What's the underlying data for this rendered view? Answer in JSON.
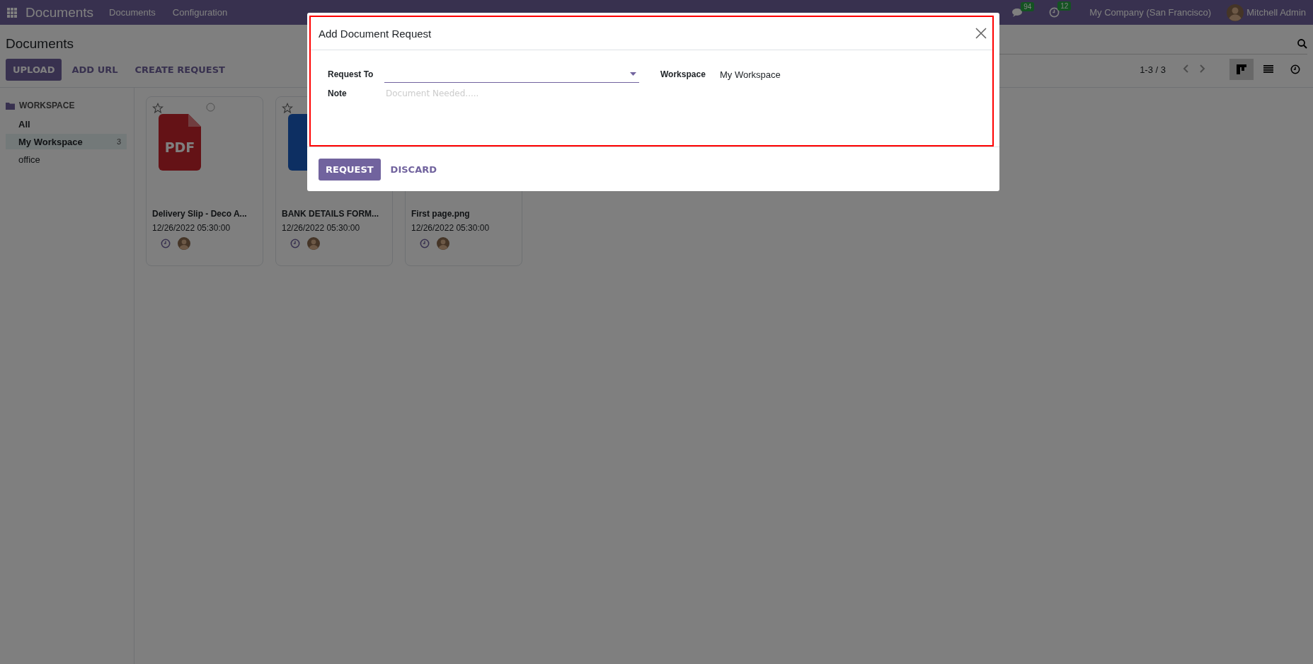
{
  "navbar": {
    "app_name": "Documents",
    "menus": [
      "Documents",
      "Configuration"
    ],
    "messages_count": "94",
    "activities_count": "12",
    "company": "My Company (San Francisco)",
    "user": "Mitchell Admin"
  },
  "control_panel": {
    "title": "Documents",
    "buttons": [
      {
        "label": "UPLOAD",
        "kind": "primary"
      },
      {
        "label": "ADD URL",
        "kind": "link"
      },
      {
        "label": "CREATE REQUEST",
        "kind": "link"
      }
    ],
    "pager": "1-3 / 3",
    "views": [
      {
        "kind": "kanban",
        "selected": true
      },
      {
        "kind": "list",
        "selected": false
      },
      {
        "kind": "activity",
        "selected": false
      }
    ]
  },
  "sidebar": {
    "heading": "WORKSPACE",
    "items": [
      {
        "label": "All",
        "selected": false,
        "bold": true
      },
      {
        "label": "My Workspace",
        "count": "3",
        "selected": true,
        "bold": true
      },
      {
        "label": "office",
        "selected": false,
        "bold": false
      }
    ]
  },
  "cards": [
    {
      "name": "Delivery Slip - Deco A...",
      "date": "12/26/2022 05:30:00",
      "kind": "pdf",
      "icon_label": "PDF",
      "corner_icons": [
        {
          "kind": "star"
        },
        {
          "kind": "select"
        }
      ]
    },
    {
      "name": "BANK DETAILS FORM...",
      "date": "12/26/2022 05:30:00",
      "kind": "doc",
      "corner_icons": [
        {
          "kind": "star"
        }
      ]
    },
    {
      "name": "First page.png",
      "date": "12/26/2022 05:30:00",
      "kind": "covered"
    }
  ],
  "dialog": {
    "title": "Add Document Request",
    "fields": [
      {
        "label": "Request To",
        "kind": "select"
      },
      {
        "label": "Workspace",
        "kind": "text",
        "value": "My Workspace"
      },
      {
        "label": "Note",
        "kind": "input",
        "placeholder": "Document Needed....."
      }
    ],
    "buttons": [
      {
        "label": "REQUEST",
        "kind": "primary"
      },
      {
        "label": "DISCARD",
        "kind": "link"
      }
    ],
    "highlighted": true
  }
}
